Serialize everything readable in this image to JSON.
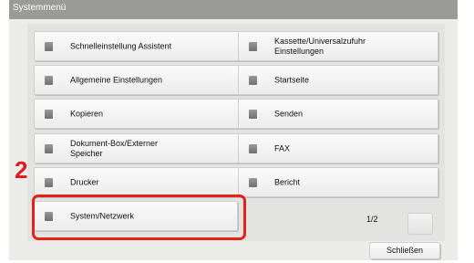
{
  "window": {
    "title": "Systemmenü"
  },
  "step_number": "2",
  "menu": {
    "left": [
      "Schnelleinstellung Assistent",
      "Allgemeine Einstellungen",
      "Kopieren",
      "Dokument-Box/Externer Speicher",
      "Drucker",
      "System/Netzwerk"
    ],
    "right": [
      "Kassette/Universalzufuhr Einstellungen",
      "Startseite",
      "Senden",
      "FAX",
      "Bericht"
    ]
  },
  "pager": {
    "page": "1/2"
  },
  "close_label": "Schließen",
  "colors": {
    "highlight": "#e3231a",
    "step_number": "#e11b1b",
    "titlebar": "#9a9a98"
  }
}
